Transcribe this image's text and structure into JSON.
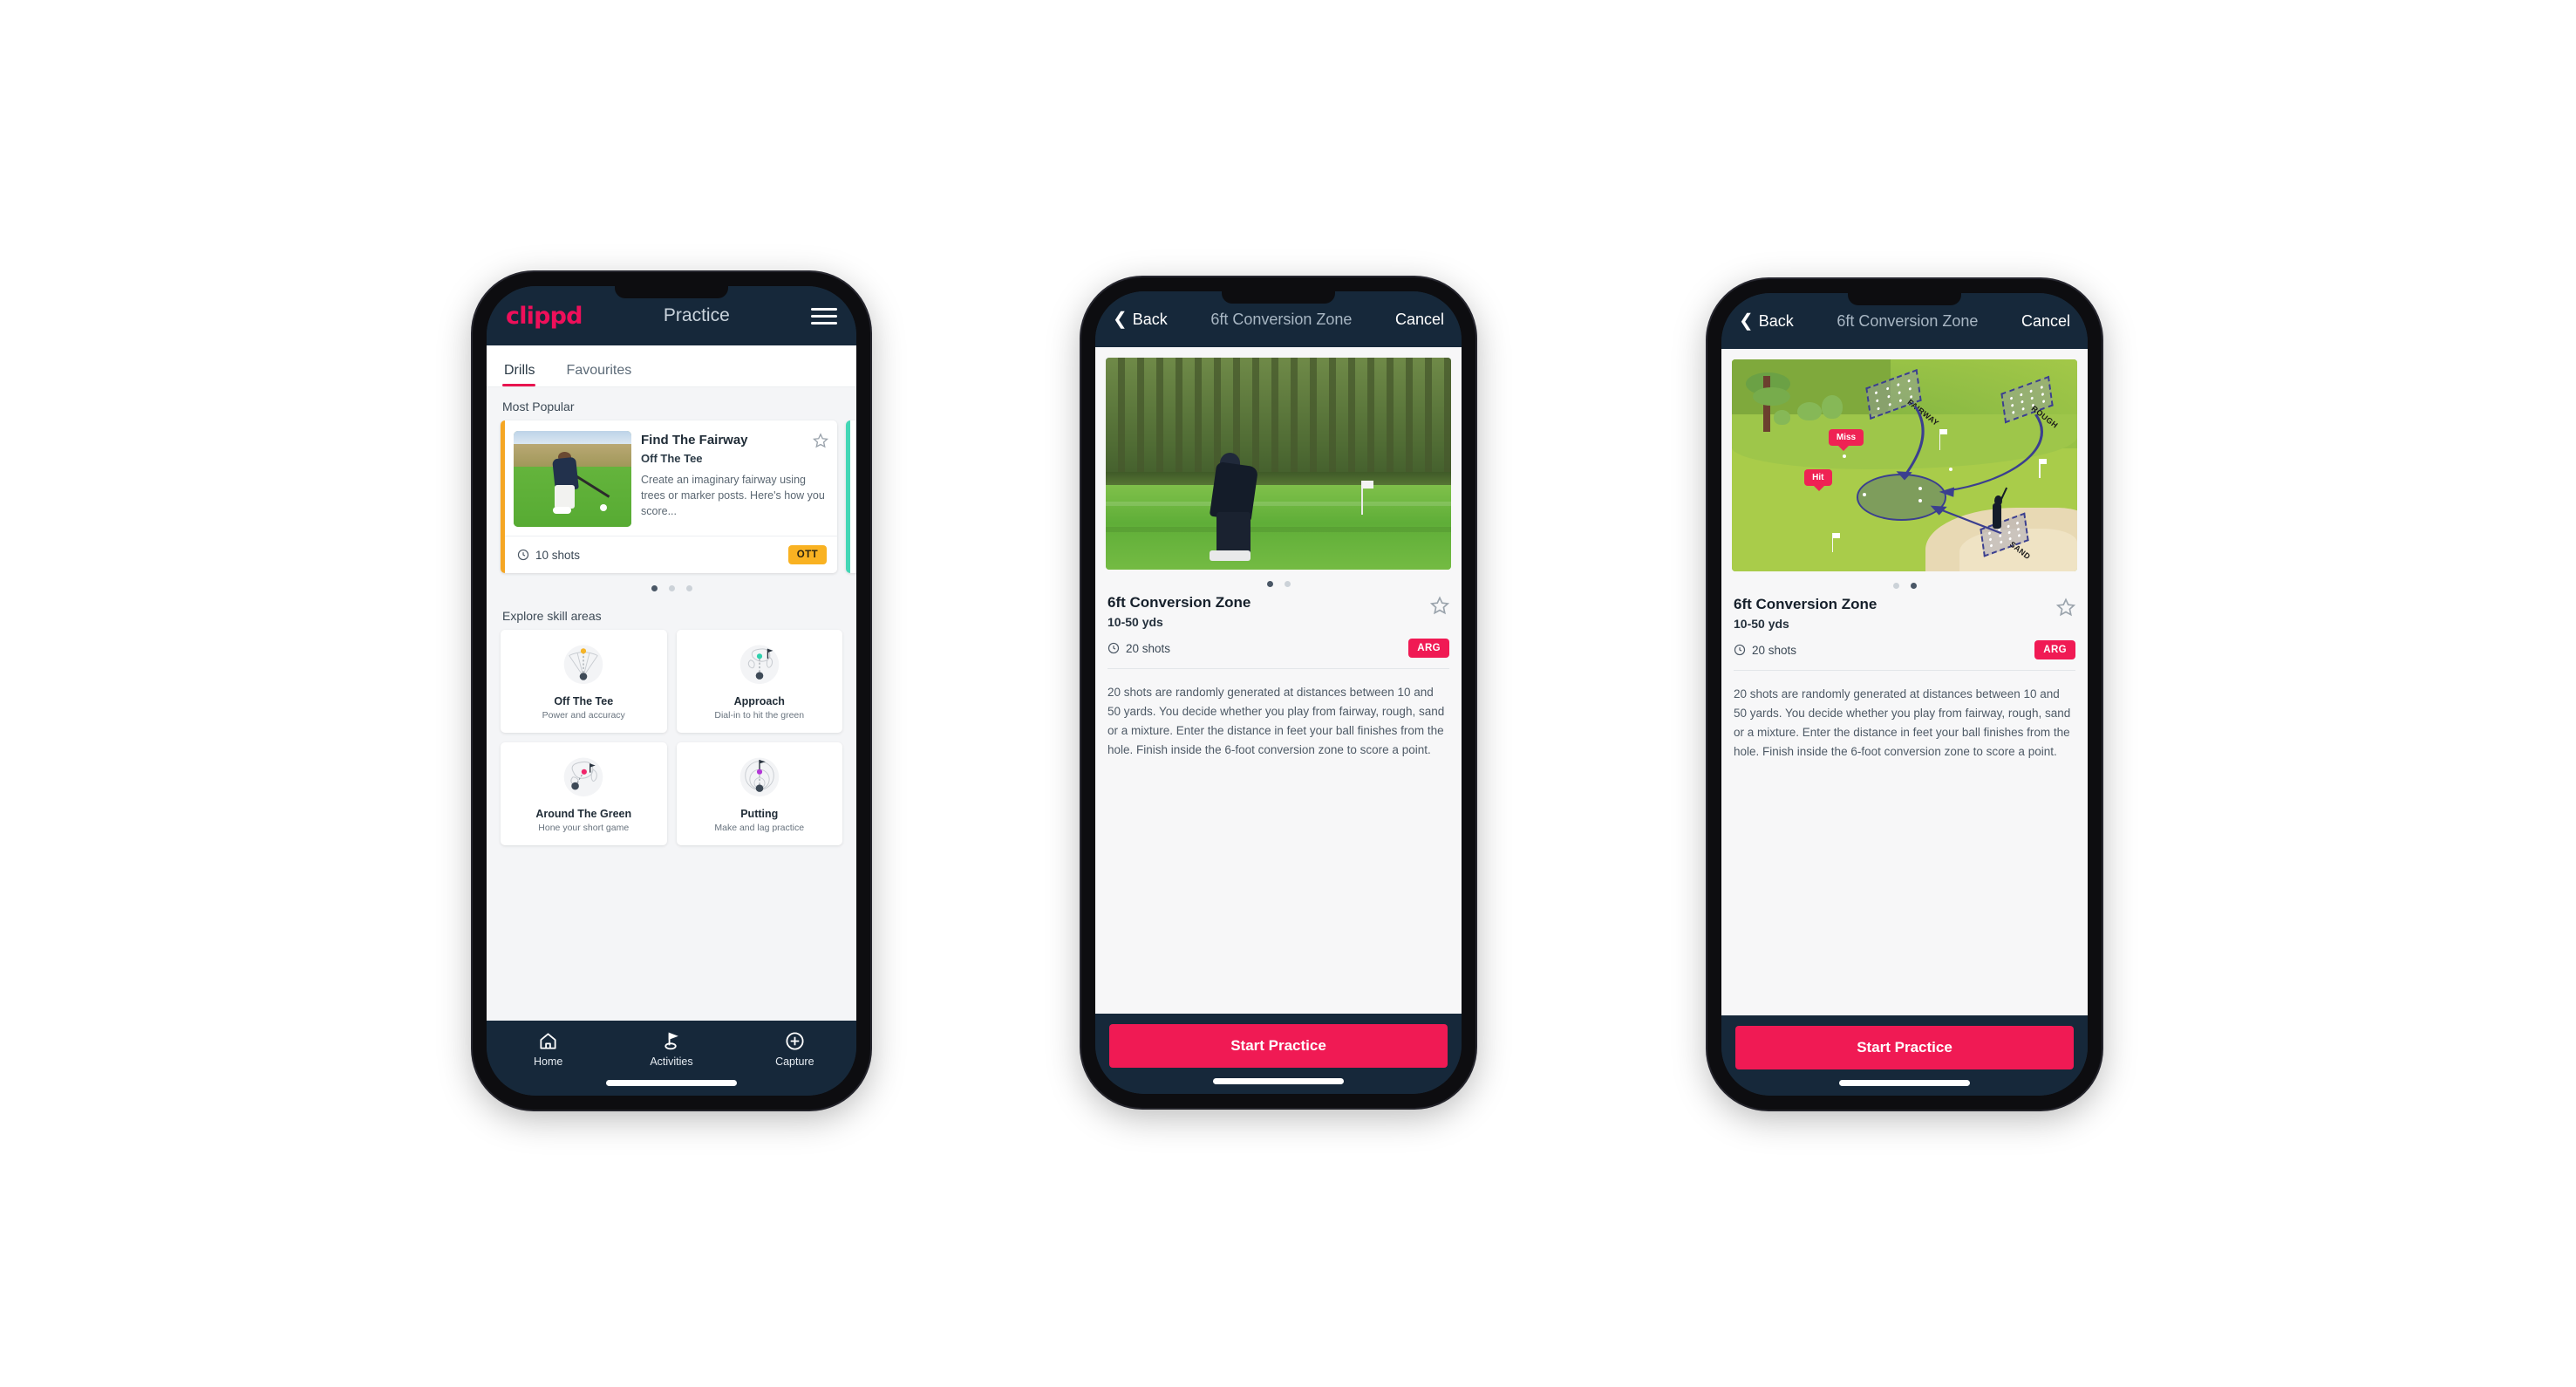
{
  "phone1": {
    "topbar": {
      "logo": "clippd",
      "title": "Practice",
      "menu_icon": "hamburger-icon"
    },
    "tabs": [
      {
        "label": "Drills",
        "active": true
      },
      {
        "label": "Favourites",
        "active": false
      }
    ],
    "sections": {
      "most_popular_label": "Most Popular",
      "explore_label": "Explore skill areas"
    },
    "drill_card": {
      "title": "Find The Fairway",
      "subtitle": "Off The Tee",
      "description": "Create an imaginary fairway using trees or marker posts. Here's how you score...",
      "shots": "10 shots",
      "badge": "OTT",
      "badge_color": "#f9b222",
      "accent_color": "#f5a623",
      "star_icon": "star-outline-icon"
    },
    "carousel_dots": [
      true,
      false,
      false
    ],
    "skill_areas": [
      {
        "name": "Off The Tee",
        "desc": "Power and accuracy",
        "icon": "tee-fan-icon",
        "dot_color": "#f5b427"
      },
      {
        "name": "Approach",
        "desc": "Dial-in to hit the green",
        "icon": "green-target-icon",
        "dot_color": "#2fd1ad"
      },
      {
        "name": "Around The Green",
        "desc": "Hone your short game",
        "icon": "chip-icon",
        "dot_color": "#f0256a"
      },
      {
        "name": "Putting",
        "desc": "Make and lag practice",
        "icon": "putt-rings-icon",
        "dot_color": "#b236d6"
      }
    ],
    "bottom_nav": [
      {
        "label": "Home",
        "icon": "home-icon",
        "active": false
      },
      {
        "label": "Activities",
        "icon": "golf-flag-icon",
        "active": true
      },
      {
        "label": "Capture",
        "icon": "plus-circle-icon",
        "active": false
      }
    ]
  },
  "phone2": {
    "topbar": {
      "back": "Back",
      "title": "6ft Conversion Zone",
      "cancel": "Cancel",
      "back_icon": "chevron-left-icon"
    },
    "media": {
      "type": "photo",
      "alt": "golfer chipping on course"
    },
    "carousel_dots": [
      true,
      false
    ],
    "detail": {
      "title": "6ft Conversion Zone",
      "subtitle": "10-50 yds",
      "shots": "20 shots",
      "badge": "ARG",
      "badge_color": "#f01a54",
      "star_icon": "star-outline-icon",
      "description": "20 shots are randomly generated at distances between 10 and 50 yards. You decide whether you play from fairway, rough, sand or a mixture. Enter the distance in feet your ball finishes from the hole. Finish inside the 6-foot conversion zone to score a point."
    },
    "cta": "Start Practice"
  },
  "phone3": {
    "topbar": {
      "back": "Back",
      "title": "6ft Conversion Zone",
      "cancel": "Cancel",
      "back_icon": "chevron-left-icon"
    },
    "media": {
      "type": "illustration",
      "zone_labels": [
        "FAIRWAY",
        "ROUGH",
        "SAND"
      ],
      "callouts": [
        "Miss",
        "Hit"
      ]
    },
    "carousel_dots": [
      false,
      true
    ],
    "detail": {
      "title": "6ft Conversion Zone",
      "subtitle": "10-50 yds",
      "shots": "20 shots",
      "badge": "ARG",
      "badge_color": "#f01a54",
      "star_icon": "star-outline-icon",
      "description": "20 shots are randomly generated at distances between 10 and 50 yards. You decide whether you play from fairway, rough, sand or a mixture. Enter the distance in feet your ball finishes from the hole. Finish inside the 6-foot conversion zone to score a point."
    },
    "cta": "Start Practice"
  },
  "theme": {
    "brand_pink": "#ee0f5a",
    "dark_navy": "#16283a",
    "page_bg": "#f4f5f7"
  }
}
